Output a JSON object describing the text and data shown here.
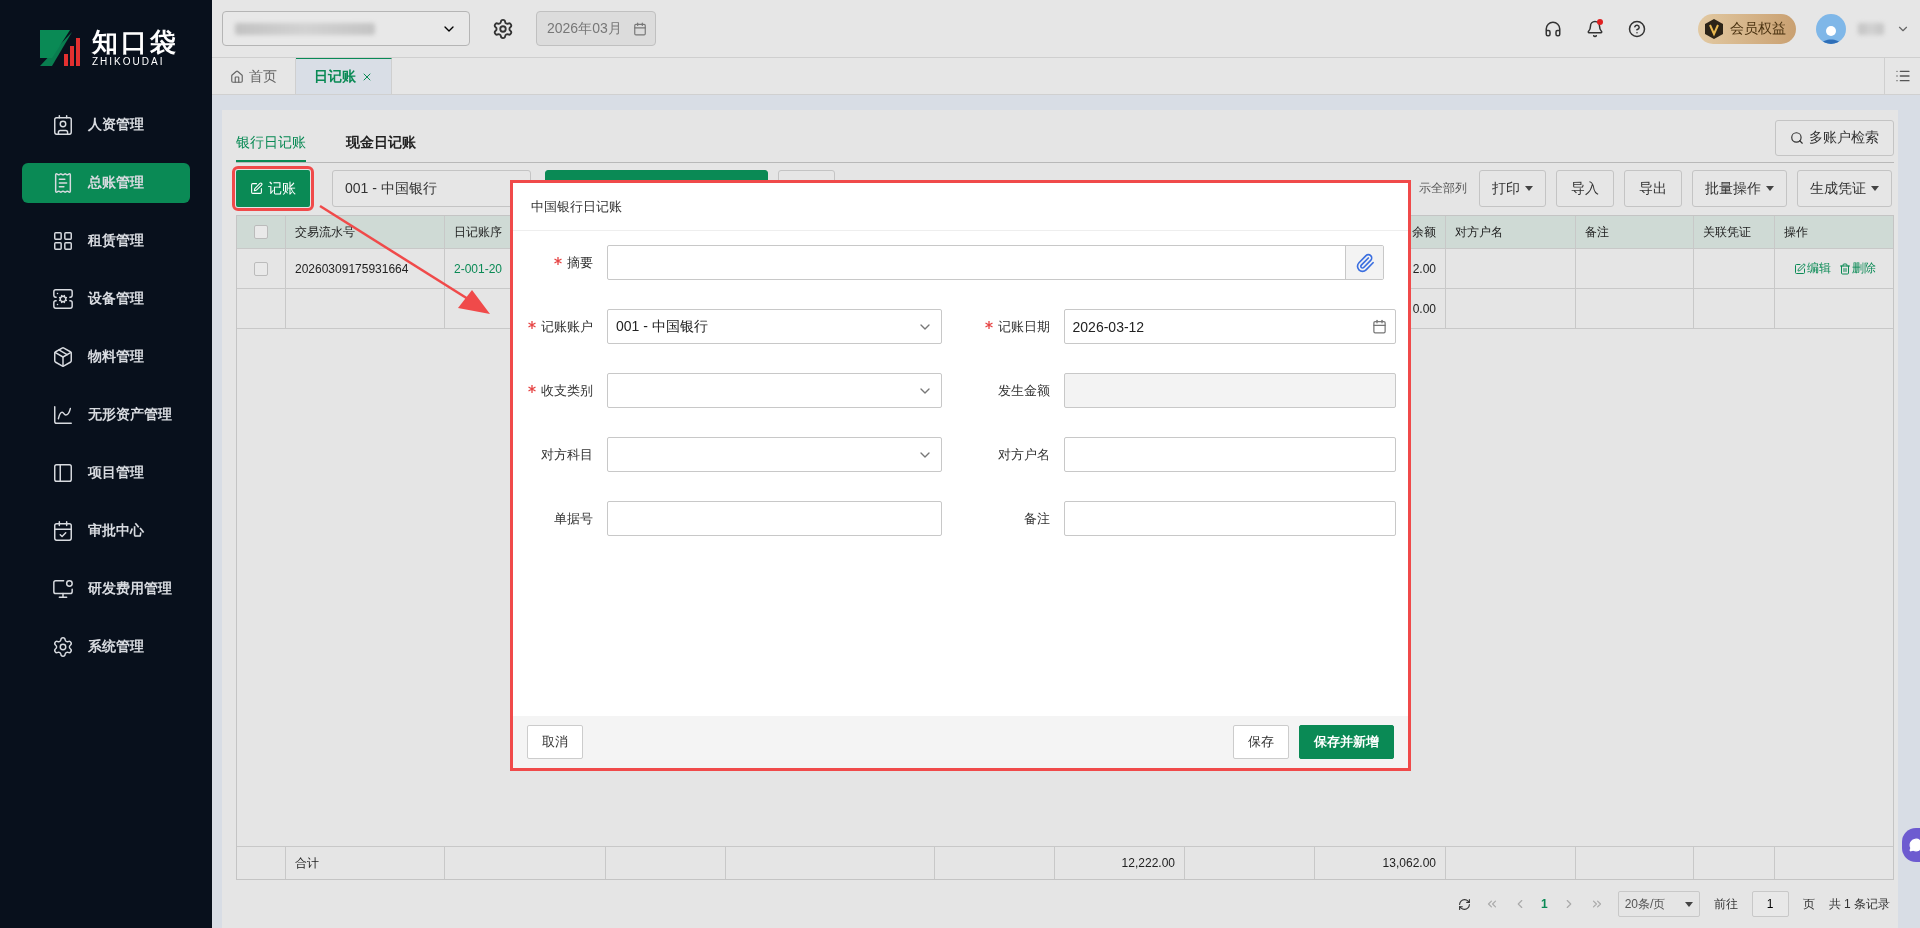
{
  "sidebar": {
    "logo": {
      "name": "知口袋",
      "subtitle": "ZHIKOUDAI"
    },
    "items": [
      {
        "label": "人资管理",
        "selected": false
      },
      {
        "label": "总账管理",
        "selected": true
      },
      {
        "label": "租赁管理",
        "selected": false
      },
      {
        "label": "设备管理",
        "selected": false
      },
      {
        "label": "物料管理",
        "selected": false
      },
      {
        "label": "无形资产管理",
        "selected": false
      },
      {
        "label": "项目管理",
        "selected": false
      },
      {
        "label": "审批中心",
        "selected": false
      },
      {
        "label": "研发费用管理",
        "selected": false
      },
      {
        "label": "系统管理",
        "selected": false
      }
    ]
  },
  "topbar": {
    "period": "2026年03月",
    "period_disabled": true,
    "member_badge": "会员权益",
    "notification_unread": true
  },
  "tabs": [
    {
      "label": "首页",
      "selected": false,
      "closable": false
    },
    {
      "label": "日记账",
      "selected": true,
      "closable": true
    }
  ],
  "journal_tabs": [
    {
      "label": "银行日记账",
      "selected": true
    },
    {
      "label": "现金日记账",
      "selected": false
    }
  ],
  "search_button": "多账户检索",
  "toolbar": {
    "record_button": "记账",
    "account_select": "001 - 中国银行",
    "show_all_columns": "示全部列",
    "buttons": [
      {
        "label": "打印",
        "dropdown": true
      },
      {
        "label": "导入",
        "dropdown": false
      },
      {
        "label": "导出",
        "dropdown": false
      },
      {
        "label": "批量操作",
        "dropdown": true
      },
      {
        "label": "生成凭证",
        "dropdown": true
      }
    ]
  },
  "table": {
    "header": {
      "select_all_checked": false,
      "serial": "交易流水号",
      "journal_no": "日记账序",
      "balance": "余额",
      "counterparty": "对方户名",
      "note": "备注",
      "voucher": "关联凭证",
      "actions": "操作"
    },
    "rows": [
      {
        "checked": false,
        "serial": "20260309175931664",
        "journal_no": "2-001-20",
        "balance": "2.00",
        "actions": [
          {
            "label": "编辑",
            "kind": "edit"
          },
          {
            "label": "删除",
            "kind": "delete"
          }
        ]
      },
      {
        "balance": "0.00"
      }
    ],
    "totals": {
      "serial": "合计",
      "column_7": "12,222.00",
      "balance": "13,062.00"
    }
  },
  "pagination": {
    "pages": [
      {
        "label": "1",
        "selected": true
      }
    ],
    "page_size": "20条/页",
    "goto_label": "前往",
    "goto_value": "1",
    "page_unit": "页",
    "total": "共 1 条记录"
  },
  "dialog": {
    "title": "中国银行日记账",
    "fields": [
      {
        "label": "摘要",
        "required": true,
        "kind": "attachment"
      },
      {
        "label": "记账账户",
        "required": true,
        "kind": "select",
        "value": "001 - 中国银行"
      },
      {
        "label": "记账日期",
        "required": true,
        "kind": "date",
        "value": "2026-03-12"
      },
      {
        "label": "收支类别",
        "required": true,
        "kind": "select"
      },
      {
        "label": "发生金额",
        "required": false,
        "kind": "disabled"
      },
      {
        "label": "对方科目",
        "required": false,
        "kind": "select"
      },
      {
        "label": "对方户名",
        "required": false,
        "kind": "text"
      },
      {
        "label": "单据号",
        "required": false,
        "kind": "text"
      },
      {
        "label": "备注",
        "required": false,
        "kind": "text"
      }
    ],
    "buttons": [
      {
        "label": "取消",
        "kind": "default"
      },
      {
        "label": "保存",
        "kind": "default"
      },
      {
        "label": "保存并新增",
        "kind": "primary"
      }
    ]
  }
}
